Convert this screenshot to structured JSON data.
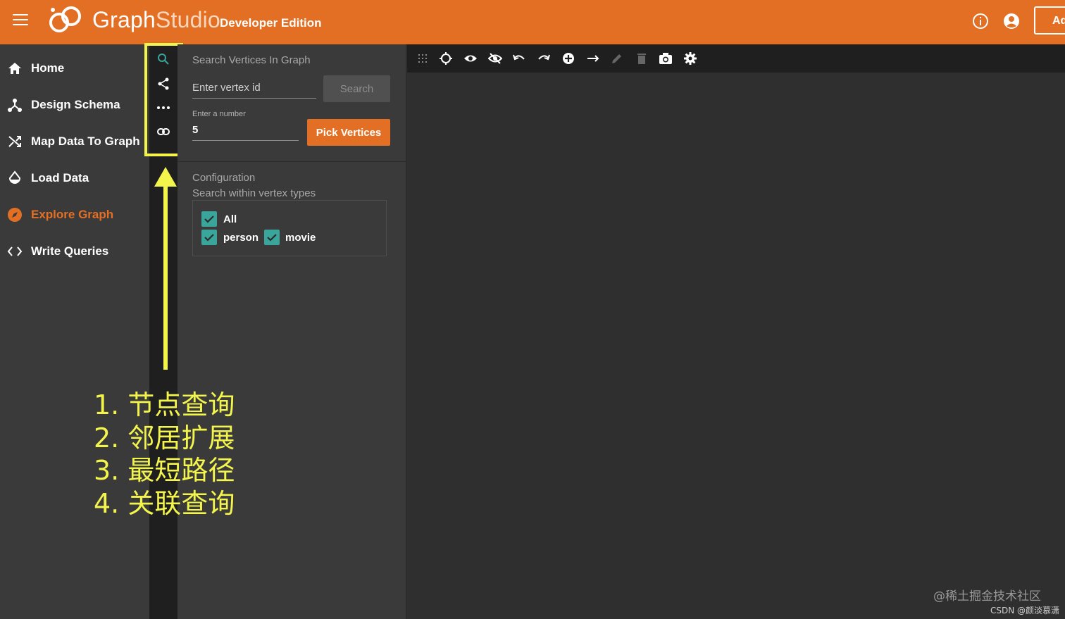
{
  "header": {
    "brand_part1": "Graph",
    "brand_part2": "Studio",
    "edition": "Developer Edition",
    "add_button": "Ad",
    "menu_icon": "hamburger-menu-icon",
    "info_icon": "info-icon",
    "account_icon": "account-circle-icon"
  },
  "nav": {
    "items": [
      {
        "label": "Home",
        "icon": "home-icon",
        "active": false
      },
      {
        "label": "Design Schema",
        "icon": "schema-icon",
        "active": false
      },
      {
        "label": "Map Data To Graph",
        "icon": "shuffle-icon",
        "active": false
      },
      {
        "label": "Load Data",
        "icon": "drop-icon",
        "active": false
      },
      {
        "label": "Explore Graph",
        "icon": "compass-icon",
        "active": true
      },
      {
        "label": "Write Queries",
        "icon": "code-icon",
        "active": false
      }
    ]
  },
  "tool_strip": {
    "items": [
      "search-icon",
      "share-expand-icon",
      "path-dots-icon",
      "link-icon"
    ]
  },
  "search_panel": {
    "title": "Search Vertices In Graph",
    "vertex_placeholder": "Enter vertex id",
    "search_button": "Search",
    "number_label": "Enter a number",
    "number_value": "5",
    "pick_button": "Pick Vertices",
    "config_title": "Configuration",
    "config_subtitle": "Search within vertex types",
    "checkboxes": [
      {
        "label": "All",
        "checked": true
      },
      {
        "label": "person",
        "checked": true
      },
      {
        "label": "movie",
        "checked": true
      }
    ]
  },
  "canvas_toolbar": {
    "items": [
      "grid-icon",
      "locate-icon",
      "eye-icon",
      "eye-off-icon",
      "undo-icon",
      "redo-icon",
      "add-circle-icon",
      "arrow-right-icon",
      "edit-pencil-icon",
      "delete-icon",
      "camera-icon",
      "settings-gear-icon"
    ]
  },
  "annotation": {
    "lines": [
      "1. 节点查询",
      "2. 邻居扩展",
      "3. 最短路径",
      "4. 关联查询"
    ]
  },
  "watermark": {
    "line1": "@稀土掘金技术社区",
    "line2": "CSDN @颜淡慕潇"
  },
  "colors": {
    "brand_orange": "#e36f24",
    "highlight_yellow": "#f3f44c",
    "checkbox_teal": "#3aa59b"
  }
}
